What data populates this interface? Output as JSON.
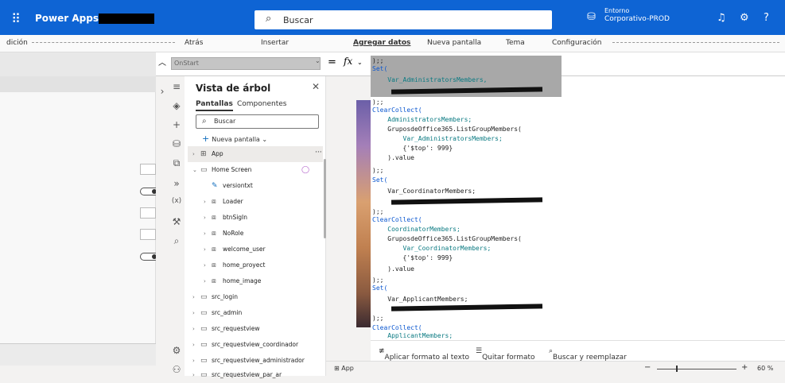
{
  "header": {
    "app_name": "Power Apps |",
    "search_placeholder": "Buscar",
    "environment_label": "Entorno",
    "environment_name": "Corporativo-PROD",
    "accent": "#0e64d4"
  },
  "commandbar": {
    "items": [
      "dición",
      "Atrás",
      "Insertar",
      "Agregar datos",
      "Nueva pantalla",
      "Tema",
      "Configuración"
    ]
  },
  "formula": {
    "property": "OnStart",
    "equals": "=",
    "fx": "fx"
  },
  "tree": {
    "title": "Vista de árbol",
    "tabs": [
      "Pantallas",
      "Componentes"
    ],
    "search_placeholder": "Buscar",
    "new_screen": "Nueva pantalla",
    "items": [
      {
        "label": "App",
        "level": 0,
        "type": "app"
      },
      {
        "label": "Home Screen",
        "level": 0,
        "type": "screen"
      },
      {
        "label": "versiontxt",
        "level": 1,
        "type": "control"
      },
      {
        "label": "Loader",
        "level": 1,
        "type": "group"
      },
      {
        "label": "btnSigIn",
        "level": 1,
        "type": "group"
      },
      {
        "label": "NoRole",
        "level": 1,
        "type": "group"
      },
      {
        "label": "welcome_user",
        "level": 1,
        "type": "group"
      },
      {
        "label": "home_proyect",
        "level": 1,
        "type": "group"
      },
      {
        "label": "home_image",
        "level": 1,
        "type": "group"
      },
      {
        "label": "src_login",
        "level": 0,
        "type": "screen"
      },
      {
        "label": "src_admin",
        "level": 0,
        "type": "screen"
      },
      {
        "label": "src_requestview",
        "level": 0,
        "type": "screen"
      },
      {
        "label": "src_requestview_coordinador",
        "level": 0,
        "type": "screen"
      },
      {
        "label": "src_requestview_administrador",
        "level": 0,
        "type": "screen"
      },
      {
        "label": "src_requestview_par_ar",
        "level": 0,
        "type": "screen"
      }
    ]
  },
  "code": {
    "lines": [
      ");;",
      "Set(",
      "    Var_AdministratorsMembers,",
      "",
      ");;",
      "ClearCollect(",
      "    AdministratorsMembers;",
      "    GruposdeOffice365.ListGroupMembers(",
      "        Var_AdministratorsMembers;",
      "        {'$top': 999}",
      "    ).value",
      ");;",
      "Set(",
      "    Var_CoordinatorMembers;",
      "",
      ");;",
      "ClearCollect(",
      "    CoordinatorMembers;",
      "    GruposdeOffice365.ListGroupMembers(",
      "        Var_CoordinatorMembers;",
      "        {'$top': 999}",
      "    ).value",
      ");;",
      "Set(",
      "    Var_ApplicantMembers;",
      "",
      ");;",
      "ClearCollect(",
      "    ApplicantMembers;"
    ]
  },
  "format_bar": {
    "format_text": "Aplicar formato al texto",
    "remove_format": "Quitar formato",
    "find_replace": "Buscar y reemplazar"
  },
  "status": {
    "screen": "App",
    "zoom_minus": "−",
    "zoom_plus": "+",
    "zoom_percent": "60 %"
  }
}
